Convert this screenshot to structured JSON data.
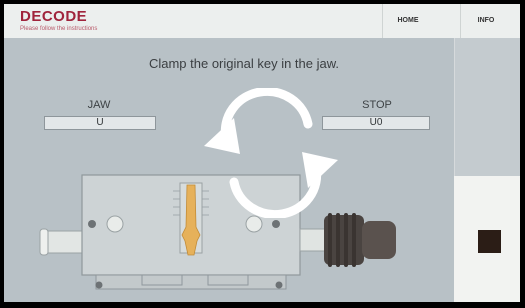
{
  "header": {
    "title": "DECODE",
    "subtitle": "Please follow the instructions",
    "nav": {
      "home": "HOME",
      "info": "INFO"
    }
  },
  "main": {
    "instruction": "Clamp the original key in the jaw.",
    "jaw": {
      "label": "JAW",
      "value": "U"
    },
    "stop": {
      "label": "STOP",
      "value": "U0"
    }
  },
  "icons": {
    "rotate": "rotate-arrows-icon",
    "stop": "stop-square-icon"
  },
  "colors": {
    "brand": "#a0243c",
    "background": "#b8c1c6",
    "stop_square": "#2b1d16"
  }
}
